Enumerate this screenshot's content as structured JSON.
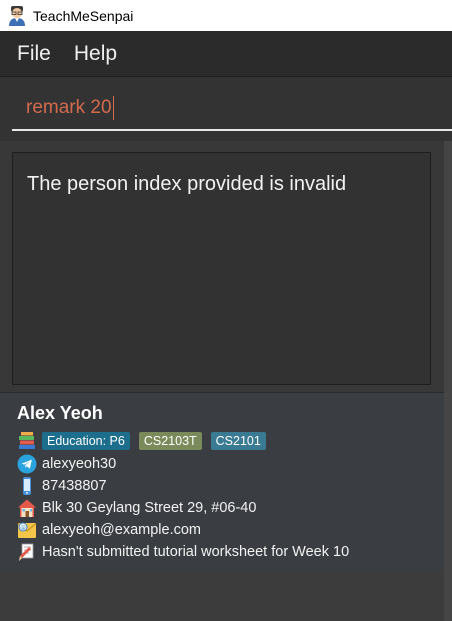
{
  "window": {
    "title": "TeachMeSenpai"
  },
  "menu": {
    "file_label": "File",
    "help_label": "Help"
  },
  "command": {
    "value": "remark 20"
  },
  "result": {
    "message": "The person index provided is invalid"
  },
  "person": {
    "name": "Alex Yeoh",
    "tags": [
      {
        "label": "Education: P6",
        "color": "#1c6e8c"
      },
      {
        "label": "CS2103T",
        "color": "#7b8a5a"
      },
      {
        "label": "CS2101",
        "color": "#3b7a93"
      }
    ],
    "telegram": "alexyeoh30",
    "phone": "87438807",
    "address": "Blk 30 Geylang Street 29, #06-40",
    "email": "alexyeoh@example.com",
    "remark": "Hasn't submitted tutorial worksheet for Week 10"
  },
  "icons": {
    "app": "senpai-icon",
    "tags": "books-icon",
    "telegram": "telegram-icon",
    "phone": "phone-icon",
    "address": "house-icon",
    "email": "email-icon",
    "remark": "remark-icon"
  }
}
